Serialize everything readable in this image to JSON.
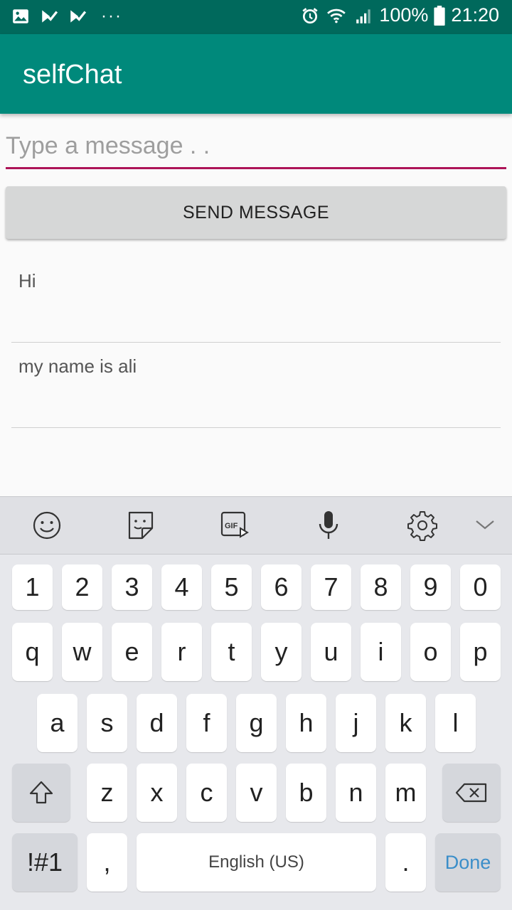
{
  "status_bar": {
    "battery": "100%",
    "time": "21:20",
    "dots": "···"
  },
  "app_bar": {
    "title": "selfChat"
  },
  "composer": {
    "placeholder": "Type a message . .",
    "send_label": "SEND MESSAGE"
  },
  "messages": [
    {
      "text": "Hi"
    },
    {
      "text": "my name is ali"
    }
  ],
  "keyboard": {
    "toolbar_icons": [
      "emoji-icon",
      "sticker-icon",
      "gif-icon",
      "microphone-icon",
      "settings-icon",
      "collapse-icon"
    ],
    "row1": [
      "1",
      "2",
      "3",
      "4",
      "5",
      "6",
      "7",
      "8",
      "9",
      "0"
    ],
    "row2": [
      "q",
      "w",
      "e",
      "r",
      "t",
      "y",
      "u",
      "i",
      "o",
      "p"
    ],
    "row3": [
      "a",
      "s",
      "d",
      "f",
      "g",
      "h",
      "j",
      "k",
      "l"
    ],
    "row4": [
      "z",
      "x",
      "c",
      "v",
      "b",
      "n",
      "m"
    ],
    "symbols_label": "!#1",
    "comma": ",",
    "space_label": "English (US)",
    "period": ".",
    "done_label": "Done"
  },
  "colors": {
    "status_bar": "#00695c",
    "app_bar": "#00897b",
    "input_underline": "#ad1457",
    "done": "#3b8ec9"
  }
}
